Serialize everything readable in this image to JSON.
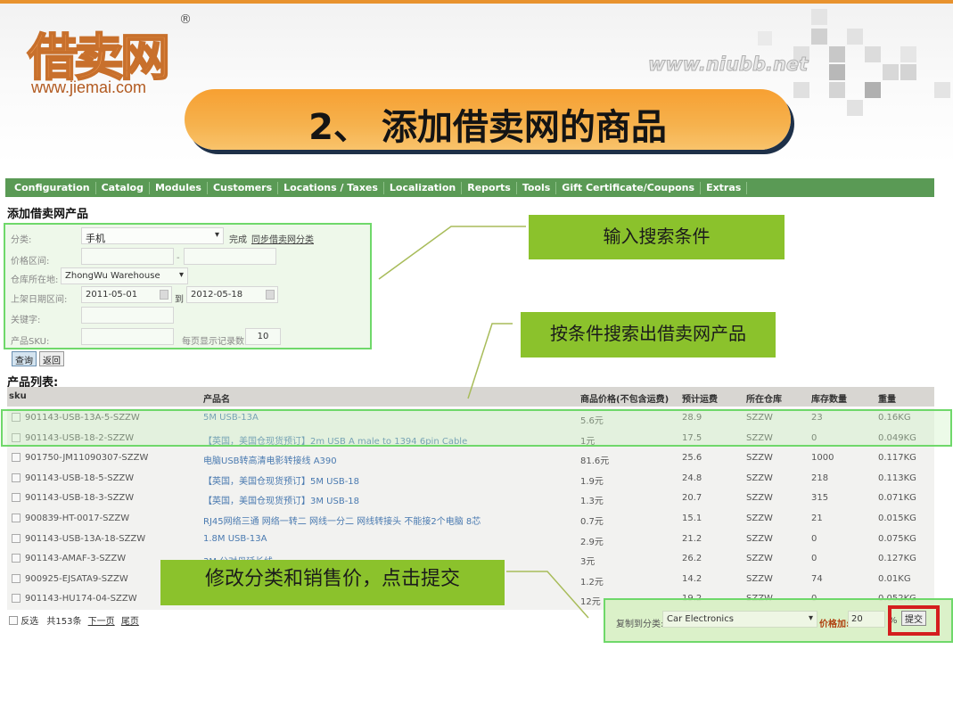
{
  "brand": {
    "logo_text": "借卖网",
    "registered_mark": "®",
    "url": "www.jiemai.com",
    "watermark": "www.niubb.net"
  },
  "banner": {
    "title": "2、 添加借卖网的商品"
  },
  "nav": {
    "items": [
      "Configuration",
      "Catalog",
      "Modules",
      "Customers",
      "Locations / Taxes",
      "Localization",
      "Reports",
      "Tools",
      "Gift Certificate/Coupons",
      "Extras"
    ]
  },
  "page_title": "添加借卖网产品",
  "form": {
    "category_label": "分类:",
    "category_value": "手机",
    "done_label": "完成",
    "sync_link": "同步借卖网分类",
    "price_range_label": "价格区间:",
    "price_from": "",
    "price_to": "",
    "price_separator": "-",
    "warehouse_label": "仓库所在地:",
    "warehouse_value": "ZhongWu Warehouse",
    "date_range_label": "上架日期区间:",
    "date_from": "2011-05-01",
    "date_to": "2012-05-18",
    "date_separator": "到",
    "keyword_label": "关键字:",
    "keyword_value": "",
    "sku_label": "产品SKU:",
    "sku_value": "",
    "per_page_label": "每页显示记录数:",
    "per_page_value": "10",
    "query_button": "查询",
    "back_button": "返回"
  },
  "list_title": "产品列表:",
  "table": {
    "columns": [
      "sku",
      "产品名",
      "商品价格(不包含运费)",
      "预计运费",
      "所在仓库",
      "库存数量",
      "重量"
    ],
    "rows": [
      {
        "sku": "901143-USB-13A-5-SZZW",
        "name": "5M USB-13A",
        "price": "5.6元",
        "shipping": "28.9",
        "warehouse": "SZZW",
        "stock": "23",
        "weight": "0.16KG"
      },
      {
        "sku": "901143-USB-18-2-SZZW",
        "name": "【英国，美国仓现货预订】2m USB A male to 1394 6pin Cable",
        "price": "1元",
        "shipping": "17.5",
        "warehouse": "SZZW",
        "stock": "0",
        "weight": "0.049KG"
      },
      {
        "sku": "901750-JM11090307-SZZW",
        "name": "电脑USB转高清电影转接线 A390",
        "price": "81.6元",
        "shipping": "25.6",
        "warehouse": "SZZW",
        "stock": "1000",
        "weight": "0.117KG"
      },
      {
        "sku": "901143-USB-18-5-SZZW",
        "name": "【英国，美国仓现货预订】5M USB-18",
        "price": "1.9元",
        "shipping": "24.8",
        "warehouse": "SZZW",
        "stock": "218",
        "weight": "0.113KG"
      },
      {
        "sku": "901143-USB-18-3-SZZW",
        "name": "【英国，美国仓现货预订】3M USB-18",
        "price": "1.3元",
        "shipping": "20.7",
        "warehouse": "SZZW",
        "stock": "315",
        "weight": "0.071KG"
      },
      {
        "sku": "900839-HT-0017-SZZW",
        "name": "RJ45网络三通 网络一转二 网线一分二 网线转接头 不能接2个电脑 8芯",
        "price": "0.7元",
        "shipping": "15.1",
        "warehouse": "SZZW",
        "stock": "21",
        "weight": "0.015KG"
      },
      {
        "sku": "901143-USB-13A-18-SZZW",
        "name": "1.8M USB-13A",
        "price": "2.9元",
        "shipping": "21.2",
        "warehouse": "SZZW",
        "stock": "0",
        "weight": "0.075KG"
      },
      {
        "sku": "901143-AMAF-3-SZZW",
        "name": "3M 公对母延长线",
        "price": "3元",
        "shipping": "26.2",
        "warehouse": "SZZW",
        "stock": "0",
        "weight": "0.127KG"
      },
      {
        "sku": "900925-EJSATA9-SZZW",
        "name": "",
        "price": "1.2元",
        "shipping": "14.2",
        "warehouse": "SZZW",
        "stock": "74",
        "weight": "0.01KG"
      },
      {
        "sku": "901143-HU174-04-SZZW",
        "name": "",
        "price": "12元",
        "shipping": "19.2",
        "warehouse": "SZZW",
        "stock": "0",
        "weight": "0.052KG"
      }
    ]
  },
  "footer": {
    "invert_label": "反选",
    "total": "共153条",
    "next_page": "下一页",
    "last_page": "尾页"
  },
  "bulk_action": {
    "copy_to_category_label": "复制到分类:",
    "category_value": "Car Electronics",
    "price_add_label": "价格加:",
    "price_add_value": "20",
    "percent_sign": "%",
    "submit_button": "提交"
  },
  "callouts": {
    "search_conditions": "输入搜索条件",
    "search_results": "按条件搜索出借卖网产品",
    "modify_submit": "修改分类和销售价，点击提交"
  },
  "colors": {
    "nav_green": "#5a9a55",
    "callout_green": "#8bc22c",
    "highlight_border": "#6fd86a",
    "banner_orange": "#f7a032",
    "submit_highlight_red": "#d41e1e"
  }
}
